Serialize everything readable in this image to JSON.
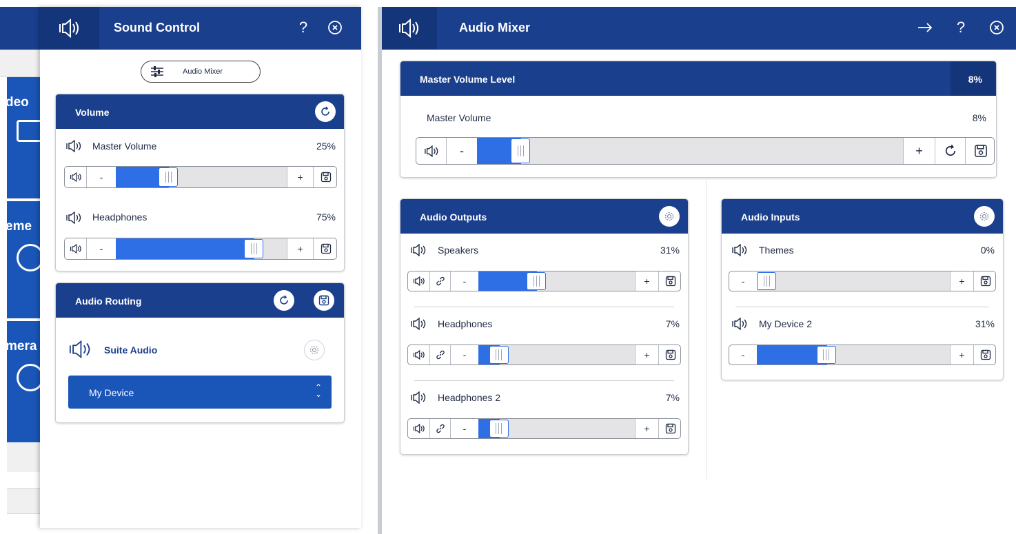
{
  "background_app": {
    "tiles": [
      "deo",
      "eme",
      "mera"
    ]
  },
  "sound_control": {
    "title": "Sound Control",
    "help_label": "?",
    "mixer_button_label": "Audio Mixer",
    "volume": {
      "title": "Volume",
      "channels": [
        {
          "label": "Master Volume",
          "value": "25%",
          "level": 0.25
        },
        {
          "label": "Headphones",
          "value": "75%",
          "level": 0.75
        }
      ],
      "minus": "-",
      "plus": "+"
    },
    "routing": {
      "title": "Audio Routing",
      "source_label": "Suite Audio",
      "device_selected": "My Device"
    }
  },
  "audio_mixer": {
    "title": "Audio Mixer",
    "help_label": "?",
    "master": {
      "title": "Master Volume Level",
      "header_value": "8%",
      "label": "Master Volume",
      "value": "8%",
      "level": 0.08,
      "minus": "-",
      "plus": "+"
    },
    "outputs": {
      "title": "Audio Outputs",
      "channels": [
        {
          "label": "Speakers",
          "value": "31%",
          "level": 0.31
        },
        {
          "label": "Headphones",
          "value": "7%",
          "level": 0.07
        },
        {
          "label": "Headphones 2",
          "value": "7%",
          "level": 0.07
        }
      ]
    },
    "inputs": {
      "title": "Audio Inputs",
      "channels": [
        {
          "label": "Themes",
          "value": "0%",
          "level": 0.0
        },
        {
          "label": "My Device 2",
          "value": "31%",
          "level": 0.31
        }
      ]
    },
    "minus": "-",
    "plus": "+"
  },
  "colors": {
    "header": "#1a3f8c",
    "accent": "#2f6fe6",
    "select": "#1a55b8"
  },
  "icons": [
    "speaker-icon",
    "sliders-icon",
    "help-icon",
    "close-icon",
    "refresh-icon",
    "save-icon",
    "gear-icon",
    "link-icon",
    "arrow-right-icon",
    "chevron-updown-icon"
  ]
}
